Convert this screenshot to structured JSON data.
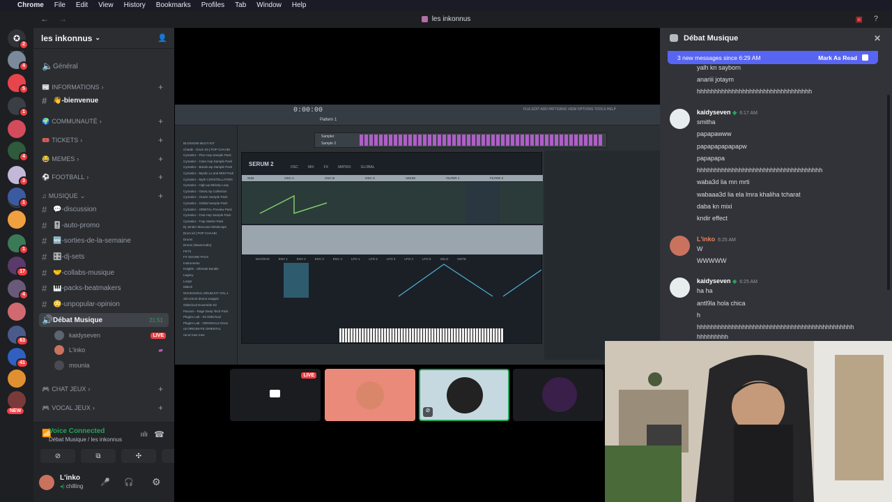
{
  "menubar": {
    "apple": "",
    "app": "Chrome",
    "items": [
      "File",
      "Edit",
      "View",
      "History",
      "Bookmarks",
      "Profiles",
      "Tab",
      "Window",
      "Help"
    ]
  },
  "window_title": "les inkonnus",
  "server": {
    "name": "les inkonnus"
  },
  "server_badges": [
    "2",
    "4",
    "5",
    "1",
    "4",
    "3",
    "1",
    "1",
    "17",
    "4",
    "63",
    "41"
  ],
  "new_label": "NEW",
  "channels": {
    "general": "Général",
    "cat_informations": "INFORMATIONS",
    "bienvenue": "👋-bienvenue",
    "cat_communaute": "COMMUNAUTÉ",
    "cat_tickets": "TICKETS",
    "cat_memes": "MEMES",
    "cat_football": "FOOTBALL",
    "cat_musique": "MUSIQUE",
    "discussion": "💬-discussion",
    "auto_promo": "🎚️-auto-promo",
    "sorties": "🆕-sorties-de-la-semaine",
    "dj_sets": "🎛️-dj-sets",
    "collabs": "🤝-collabs-musique",
    "packs": "🎹-packs-beatmakers",
    "unpopular": "😳-unpopular-opinion",
    "debat": "Débat Musique",
    "debat_time": "21:51",
    "cat_chat_jeux": "CHAT JEUX",
    "cat_vocal_jeux": "VOCAL JEUX"
  },
  "voice_users": [
    {
      "name": "kaidyseven",
      "live": "LIVE"
    },
    {
      "name": "L'inko"
    },
    {
      "name": "mounia"
    }
  ],
  "voice_panel": {
    "status": "Voice Connected",
    "location": "Débat Musique / les inkonnus"
  },
  "user_panel": {
    "name": "L'inko",
    "status": "chilling"
  },
  "daw": {
    "time": "0:00:00",
    "pattern": "Pattern 1",
    "plugin": "SERUM 2",
    "browser_items": [
      "BLOSSOM MULTI KIT",
      "Chaabi - Drum Kit | POP CHAABI",
      "Cymatics - Ploo Hop Sample Pack",
      "Cymatics - Coke Hop Sample Pack",
      "Cymatics - Bando.wp Sample Pack",
      "Cymatics - Mystic Lo and MIDI Pack",
      "Cymatics - Myth CONSTELLATION",
      "Cymatics - High.up Melody Loop",
      "Cymatics - Oasis.mp Collection",
      "Cymatics - Oracle Sample Pack",
      "Cymatics - Orbital Sample Pack",
      "Cymatics - ORBITAL Preview Pack",
      "Cymatics - Fast Hop Sample Pack",
      "Cymatics - Trap Starter Pack",
      "Dj Jender Marocain Mindscape",
      "Drum kit | POP CHAABI",
      "Drums",
      "Drums (WaveAudio)",
      "FETX",
      "FX SOUND PACK",
      "Instruments",
      "Knights - Ultimate Bundle",
      "Legacy",
      "Loops",
      "Mitech",
      "NOVESSOUL DRUM KIT VOL.1",
      "old school drums snappin",
      "Oldschool Ensemble Kit",
      "Paroom - Rage Deep Tech Pack",
      "Plugins Lab - Kit Oldschool",
      "Plugins Lab - ORIGINALS Drum",
      "rai ORIGINATE ORIENTAL",
      "rai w/ mee mee"
    ],
    "menu": "FILE EDIT ADD PATTERNS VIEW OPTIONS TOOLS HELP",
    "tabs": [
      "OSC",
      "MIX",
      "FX",
      "MATRIX",
      "GLOBAL"
    ],
    "modules": [
      "SUB",
      "OSC A",
      "OSC B",
      "OSC C",
      "NOISE",
      "FILTER 1",
      "FILTER 2"
    ],
    "lower_tabs": [
      "MACROS",
      "ENV 1",
      "ENV 2",
      "ENV 3",
      "ENV 4",
      "LFO 1",
      "LFO 2",
      "LFO 3",
      "LFO 4",
      "LFO 5",
      "VELO",
      "NOTE"
    ],
    "channels": [
      "Sampler",
      "Sample 2"
    ]
  },
  "stream_tiles": [
    {
      "live": "LIVE",
      "color": "#1b1c1f"
    },
    {
      "color": "#e98a7a"
    },
    {
      "color": "#c7d9e0"
    },
    {
      "color": "#1b1c1f"
    }
  ],
  "chat": {
    "title": "Débat Musique",
    "new_messages": "3 new messages since 6:29 AM",
    "mark_read": "Mark As Read",
    "top_lines": [
      "yalh kn sayborn",
      "anariii jotaym",
      "hhhhhhhhhhhhhhhhhhhhhhhhhhhhhhhhh"
    ],
    "groups": [
      {
        "author": "kaidyseven",
        "color": "#ffffff",
        "time": "6:17 AM",
        "lines": [
          "smitha",
          "papapawww",
          "papapapapapapw",
          "papapapa",
          "hhhhhhhhhhhhhhhhhhhhhhhhhhhhhhhhhhhh",
          "waba3d lia mn mrti",
          "wabaaa3d lia ela lmra khaliha tcharat",
          "daba kn mixi",
          "kndir effect"
        ]
      },
      {
        "author": "L'inko",
        "color": "#e8855d",
        "time": "6:25 AM",
        "lines": [
          "W",
          "WWWWW"
        ]
      },
      {
        "author": "kaidyseven",
        "color": "#ffffff",
        "time": "6:25 AM",
        "lines": [
          "ha ha",
          "antl9la hola chica",
          "h",
          "hhhhhhhhhhhhhhhhhhhhhhhhhhhhhhhhhhhhhhhhhhhhh",
          "hhhhhhhhh"
        ]
      }
    ]
  },
  "colors": {
    "accent": "#5865f2",
    "green": "#23a55a",
    "red": "#f23f43"
  }
}
